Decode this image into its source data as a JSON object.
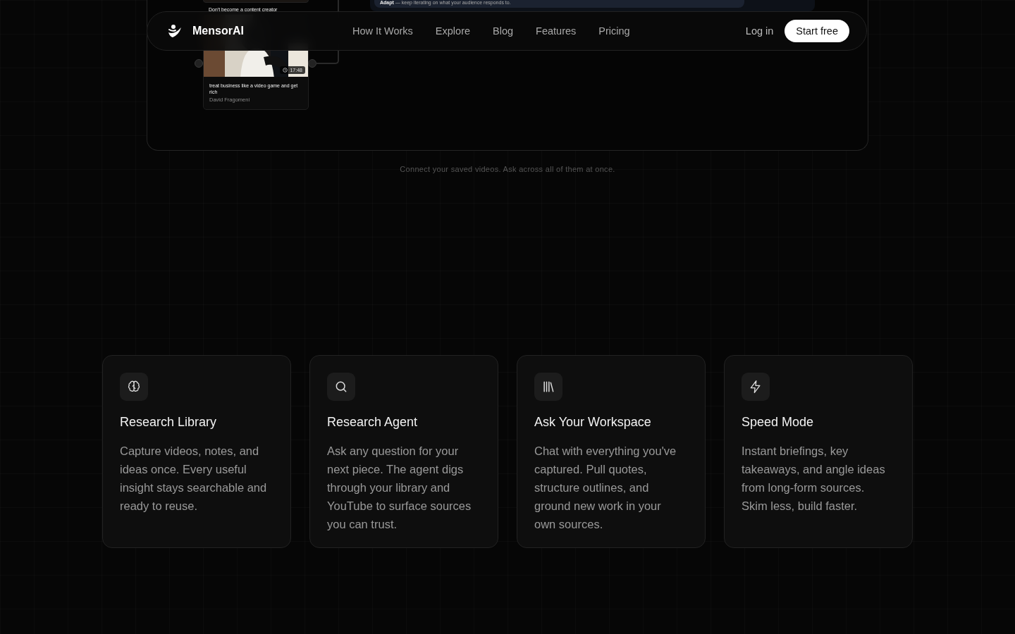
{
  "demo": {
    "cards": [
      {
        "title": "Don't become a content creator"
      },
      {
        "duration": "17:48",
        "title": "treat business like a video game and get rich",
        "author": "David Fragomeni"
      }
    ],
    "panel_text": "**Adapt** — keep iterating on what your audience responds to."
  },
  "nav": {
    "brand": "MensorAI",
    "links": [
      "How It Works",
      "Explore",
      "Blog",
      "Features",
      "Pricing"
    ],
    "login": "Log in",
    "cta": "Start free"
  },
  "caption": "Connect your saved videos. Ask across all of them at once.",
  "features": [
    {
      "title": "Research Library",
      "text": "Capture videos, notes, and ideas once. Every useful insight stays searchable and ready to reuse."
    },
    {
      "title": "Research Agent",
      "text": "Ask any question for your next piece. The agent digs through your library and YouTube to surface sources you can trust."
    },
    {
      "title": "Ask Your Workspace",
      "text": "Chat with everything you've captured. Pull quotes, structure outlines, and ground new work in your own sources."
    },
    {
      "title": "Speed Mode",
      "text": "Instant briefings, key takeaways, and angle ideas from long-form sources. Skim less, build faster."
    }
  ]
}
